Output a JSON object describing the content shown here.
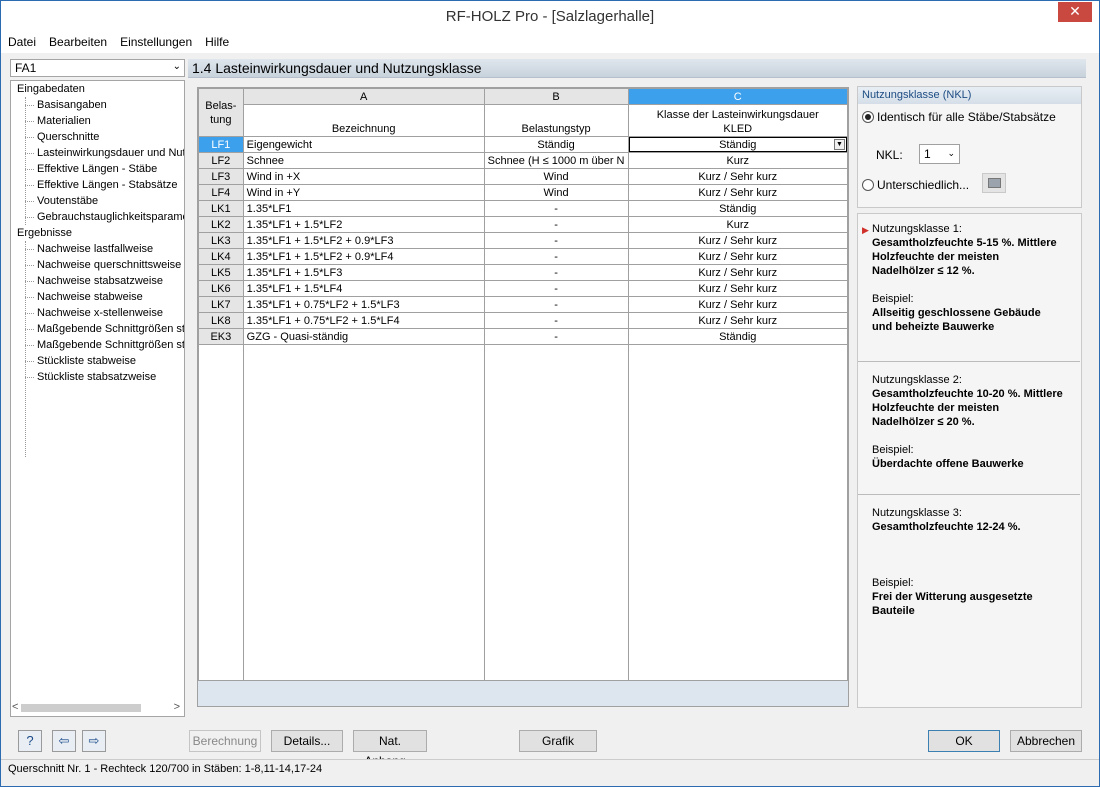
{
  "window": {
    "title": "RF-HOLZ Pro - [Salzlagerhalle]",
    "close": "✕"
  },
  "menu": [
    "Datei",
    "Bearbeiten",
    "Einstellungen",
    "Hilfe"
  ],
  "case_select": {
    "value": "FA1"
  },
  "tree": {
    "input_root": "Eingabedaten",
    "input_items": [
      "Basisangaben",
      "Materialien",
      "Querschnitte",
      "Lasteinwirkungsdauer und Nutz",
      "Effektive Längen - Stäbe",
      "Effektive Längen - Stabsätze",
      "Voutenstäbe",
      "Gebrauchstauglichkeitsparamet"
    ],
    "results_root": "Ergebnisse",
    "results_items": [
      "Nachweise lastfallweise",
      "Nachweise querschnittsweise",
      "Nachweise stabsatzweise",
      "Nachweise stabweise",
      "Nachweise x-stellenweise",
      "Maßgebende Schnittgrößen sta",
      "Maßgebende Schnittgrößen sta",
      "Stückliste stabweise",
      "Stückliste stabsatzweise"
    ]
  },
  "section_title": "1.4 Lasteinwirkungsdauer und Nutzungsklasse",
  "table": {
    "col_letters": [
      "A",
      "B",
      "C"
    ],
    "rowhdr_label_1": "Belas-",
    "rowhdr_label_2": "tung",
    "col_a_header": "Bezeichnung",
    "col_b_header": "Belastungstyp",
    "col_c_header_1": "Klasse der Lasteinwirkungsdauer",
    "col_c_header_2": "KLED",
    "rows": [
      {
        "id": "LF1",
        "name": "Eigengewicht",
        "type": "Ständig",
        "kled": "Ständig"
      },
      {
        "id": "LF2",
        "name": "Schnee",
        "type": "Schnee (H ≤ 1000 m über N",
        "kled": "Kurz"
      },
      {
        "id": "LF3",
        "name": "Wind in +X",
        "type": "Wind",
        "kled": "Kurz / Sehr kurz"
      },
      {
        "id": "LF4",
        "name": "Wind in +Y",
        "type": "Wind",
        "kled": "Kurz / Sehr kurz"
      },
      {
        "id": "LK1",
        "name": "1.35*LF1",
        "type": "-",
        "kled": "Ständig"
      },
      {
        "id": "LK2",
        "name": "1.35*LF1 + 1.5*LF2",
        "type": "-",
        "kled": "Kurz"
      },
      {
        "id": "LK3",
        "name": "1.35*LF1 + 1.5*LF2 + 0.9*LF3",
        "type": "-",
        "kled": "Kurz / Sehr kurz"
      },
      {
        "id": "LK4",
        "name": "1.35*LF1 + 1.5*LF2 + 0.9*LF4",
        "type": "-",
        "kled": "Kurz / Sehr kurz"
      },
      {
        "id": "LK5",
        "name": "1.35*LF1 + 1.5*LF3",
        "type": "-",
        "kled": "Kurz / Sehr kurz"
      },
      {
        "id": "LK6",
        "name": "1.35*LF1 + 1.5*LF4",
        "type": "-",
        "kled": "Kurz / Sehr kurz"
      },
      {
        "id": "LK7",
        "name": "1.35*LF1 + 0.75*LF2 + 1.5*LF3",
        "type": "-",
        "kled": "Kurz / Sehr kurz"
      },
      {
        "id": "LK8",
        "name": "1.35*LF1 + 0.75*LF2 + 1.5*LF4",
        "type": "-",
        "kled": "Kurz / Sehr kurz"
      },
      {
        "id": "EK3",
        "name": "GZG - Quasi-ständig",
        "type": "-",
        "kled": "Ständig"
      }
    ]
  },
  "nkl_panel": {
    "title": "Nutzungsklasse (NKL)",
    "radio_same": "Identisch für alle Stäbe/Stabsätze",
    "nkl_label": "NKL:",
    "nkl_value": "1",
    "radio_diff": "Unterschiedlich..."
  },
  "info": {
    "nk1_title": "Nutzungsklasse 1:",
    "nk1_line1": "Gesamtholzfeuchte 5-15 %. Mittlere",
    "nk1_line2": "Holzfeuchte der meisten",
    "nk1_line3": "Nadelhölzer ≤ 12 %.",
    "nk1_ex_label": "Beispiel:",
    "nk1_ex1": "Allseitig geschlossene Gebäude",
    "nk1_ex2": "und beheizte Bauwerke",
    "nk2_title": "Nutzungsklasse 2:",
    "nk2_line1": "Gesamtholzfeuchte 10-20 %. Mittlere",
    "nk2_line2": "Holzfeuchte der meisten",
    "nk2_line3": "Nadelhölzer ≤ 20 %.",
    "nk2_ex_label": "Beispiel:",
    "nk2_ex1": "Überdachte offene Bauwerke",
    "nk3_title": "Nutzungsklasse 3:",
    "nk3_line1": "Gesamtholzfeuchte 12-24 %.",
    "nk3_ex_label": "Beispiel:",
    "nk3_ex1": "Frei der Witterung ausgesetzte",
    "nk3_ex2": "Bauteile"
  },
  "buttons": {
    "help_icon": "?",
    "prev_icon": "⇦",
    "next_icon": "⇨",
    "calc": "Berechnung",
    "details": "Details...",
    "annex": "Nat. Anhang...",
    "graphic": "Grafik",
    "ok": "OK",
    "cancel": "Abbrechen"
  },
  "status": "Querschnitt Nr. 1 - Rechteck 120/700 in Stäben: 1-8,11-14,17-24"
}
